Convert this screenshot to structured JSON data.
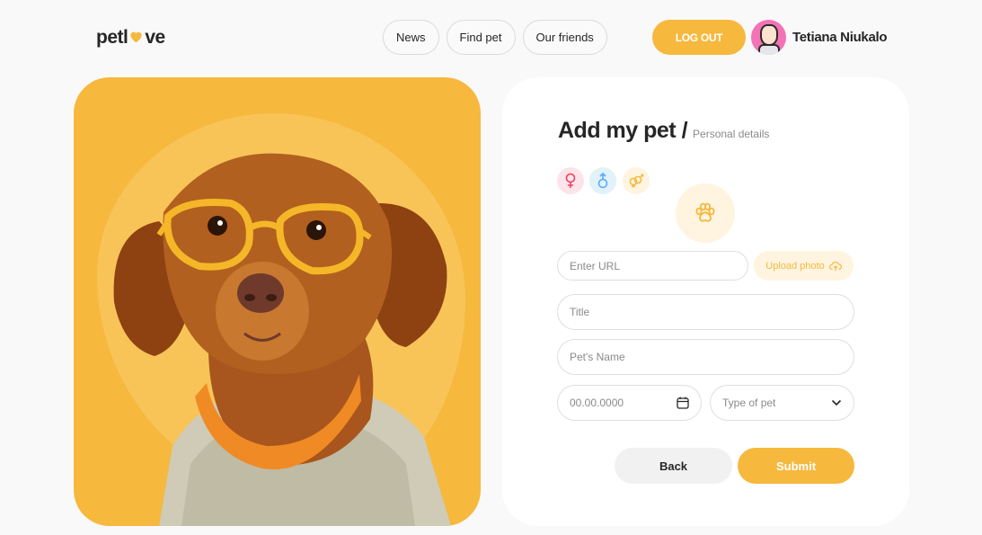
{
  "header": {
    "logo": {
      "pre": "petl",
      "post": "ve",
      "heart_icon": "heart-icon"
    },
    "nav": [
      {
        "label": "News"
      },
      {
        "label": "Find pet"
      },
      {
        "label": "Our friends"
      }
    ],
    "logout_label": "LOG OUT",
    "user": {
      "name": "Tetiana Niukalo",
      "avatar_icon": "user-avatar"
    }
  },
  "hero": {
    "image": "dog-with-glasses-photo"
  },
  "form": {
    "title": "Add my pet /",
    "subtitle": "Personal details",
    "sex_options": [
      {
        "icon": "female-icon",
        "glyph": "♀"
      },
      {
        "icon": "male-icon",
        "glyph": "♂"
      },
      {
        "icon": "multiple-sex-icon",
        "glyph": "⚥"
      }
    ],
    "photo_placeholder_icon": "paw-icon",
    "url_placeholder": "Enter URL",
    "upload_label": "Upload photo",
    "title_placeholder": "Title",
    "name_placeholder": "Pet's Name",
    "date_placeholder": "00.00.0000",
    "type_placeholder": "Type of pet",
    "back_label": "Back",
    "submit_label": "Submit"
  },
  "colors": {
    "accent": "#f6b83d",
    "accent_light": "#fff4df",
    "text": "#262626",
    "female": "#f43f5e",
    "male": "#54adff"
  }
}
